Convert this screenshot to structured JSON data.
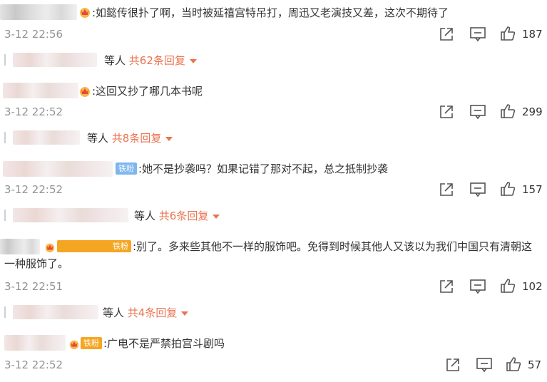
{
  "comments": [
    {
      "text": ":如懿传很扑了啊，当时被延禧宫特吊打，周迅又老演技又差，这次不期待了",
      "time": "3-12 22:56",
      "likes": "187",
      "reply_prefix": "等人",
      "reply_count": "共62条回复"
    },
    {
      "text": ":这回又抄了哪几本书呢",
      "time": "3-12 22:52",
      "likes": "299",
      "reply_prefix": "等人",
      "reply_count": "共8条回复"
    },
    {
      "badge": "铁粉",
      "text": ":她不是抄袭吗？如果记错了那对不起，总之抵制抄袭",
      "time": "3-12 22:52",
      "likes": "157",
      "reply_prefix": "等人",
      "reply_count": "共6条回复"
    },
    {
      "badge": "铁粉",
      "text": ":别了。多来些其他不一样的服饰吧。免得到时候其他人又该以为我们中国只有清朝这一种服饰了。",
      "time": "3-12 22:51",
      "likes": "102",
      "reply_prefix": "等人",
      "reply_count": "共4条回复"
    },
    {
      "badge": "铁粉",
      "text": ":广电不是严禁拍宫斗剧吗",
      "time": "3-12 22:52",
      "likes": "57"
    }
  ],
  "icons": {
    "share": "share-icon",
    "comment": "comment-icon",
    "like": "thumbs-up-icon",
    "expand": "caret-down-icon",
    "vip": "crown-icon"
  },
  "colors": {
    "accent": "#eb7350",
    "time": "#939393",
    "fan_badge": "#7fb6ee",
    "text": "#333333"
  }
}
